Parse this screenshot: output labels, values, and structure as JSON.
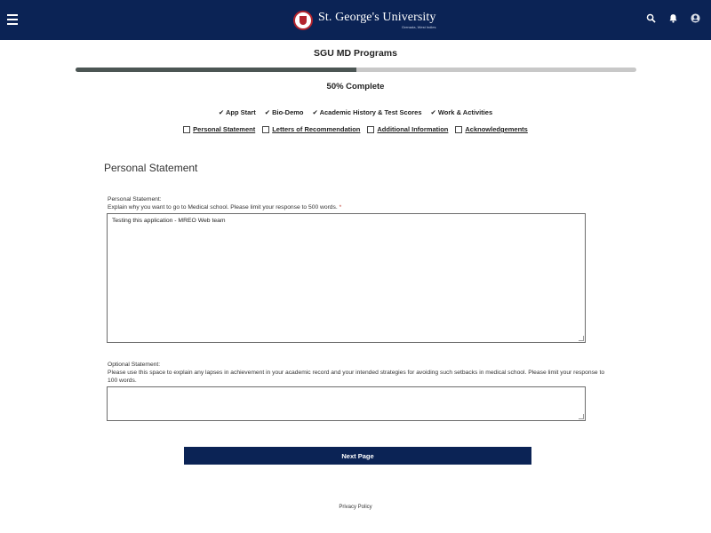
{
  "header": {
    "brand_name": "St. George's University",
    "brand_sub": "Grenada, West Indies",
    "colors": {
      "navy": "#0b2355",
      "seal_red": "#b3242e"
    },
    "icons": [
      "menu-icon",
      "search-icon",
      "bell-icon",
      "user-icon"
    ]
  },
  "progress": {
    "title": "SGU MD Programs",
    "percent": 50,
    "label": "50% Complete"
  },
  "steps": {
    "completed": [
      {
        "label": "✔ App Start"
      },
      {
        "label": "✔ Bio-Demo"
      },
      {
        "label": "✔ Academic History & Test Scores"
      },
      {
        "label": "✔ Work & Activities"
      }
    ],
    "remaining": [
      {
        "label": "Personal Statement"
      },
      {
        "label": "Letters of Recommendation"
      },
      {
        "label": "Additional Information"
      },
      {
        "label": "Acknowledgements"
      }
    ]
  },
  "section": {
    "title": "Personal Statement"
  },
  "personal_statement": {
    "label_line1": "Personal Statement:",
    "label_line2": "Explain why you want to go to Medical school. Please limit your response to 500 words.",
    "required_mark": "*",
    "value": "Testing this application - MREO Web team"
  },
  "optional_statement": {
    "label_line1": "Optional Statement:",
    "label_line2": "Please use this space to explain any lapses in achievement in your academic record and your intended strategies for avoiding such setbacks in medical school. Please limit your response to 100 words.",
    "value": ""
  },
  "actions": {
    "next_label": "Next Page"
  },
  "footer": {
    "privacy_label": "Privacy Policy"
  }
}
